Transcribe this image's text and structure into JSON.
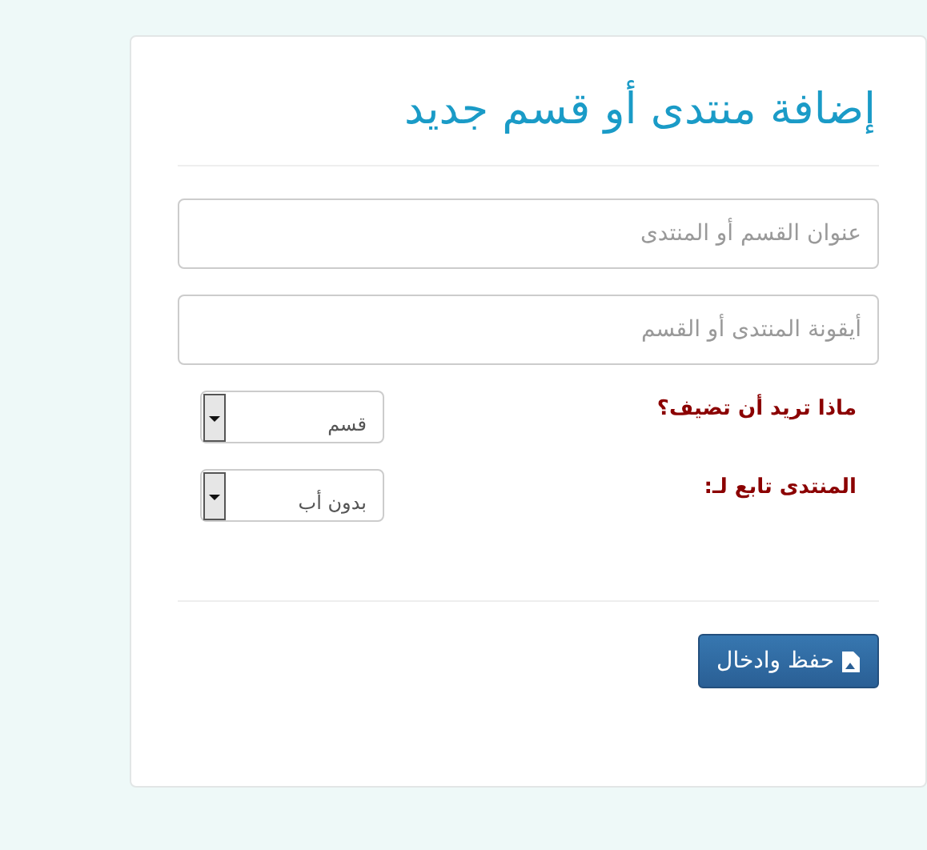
{
  "title": "إضافة منتدى أو قسم جديد",
  "fields": [
    {
      "placeholder": "عنوان القسم أو المنتدى"
    },
    {
      "placeholder": "أيقونة المنتدى أو القسم"
    }
  ],
  "selects": [
    {
      "label": "ماذا تريد أن تضيف؟",
      "value": "قسم"
    },
    {
      "label": "المنتدى تابع لـ:",
      "value": "بدون أب"
    }
  ],
  "submit_button": {
    "label": "حفظ وادخال"
  }
}
